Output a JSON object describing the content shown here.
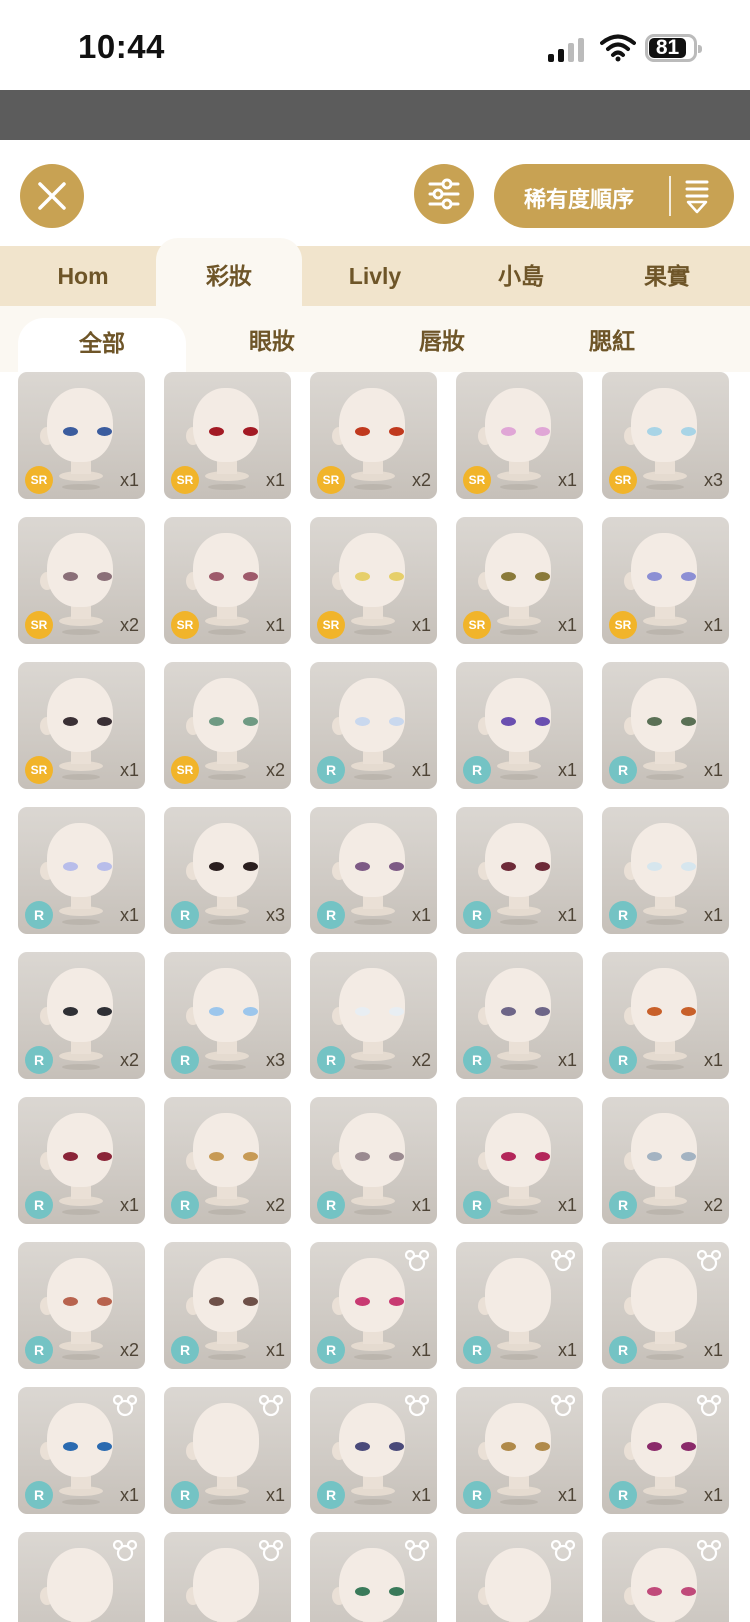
{
  "status_bar": {
    "time": "10:44",
    "battery": "81"
  },
  "toolbar": {
    "sort_label": "稀有度順序"
  },
  "tabs": [
    {
      "label": "Hom",
      "active": false
    },
    {
      "label": "彩妝",
      "active": true
    },
    {
      "label": "Livly",
      "active": false
    },
    {
      "label": "小島",
      "active": false
    },
    {
      "label": "果實",
      "active": false
    }
  ],
  "subtabs": [
    {
      "label": "全部",
      "active": true
    },
    {
      "label": "眼妝",
      "active": false
    },
    {
      "label": "唇妝",
      "active": false
    },
    {
      "label": "腮紅",
      "active": false
    }
  ],
  "items": [
    {
      "rarity": "SR",
      "qty": "x1",
      "eye": "#3b5c9e",
      "mouse": false
    },
    {
      "rarity": "SR",
      "qty": "x1",
      "eye": "#a31a24",
      "mouse": false
    },
    {
      "rarity": "SR",
      "qty": "x2",
      "eye": "#c0391e",
      "mouse": false
    },
    {
      "rarity": "SR",
      "qty": "x1",
      "eye": "#e0a6d6",
      "mouse": false
    },
    {
      "rarity": "SR",
      "qty": "x3",
      "eye": "#a8d4e6",
      "mouse": false
    },
    {
      "rarity": "SR",
      "qty": "x2",
      "eye": "#8a6f78",
      "mouse": false
    },
    {
      "rarity": "SR",
      "qty": "x1",
      "eye": "#9e5a6b",
      "mouse": false
    },
    {
      "rarity": "SR",
      "qty": "x1",
      "eye": "#e6cf6a",
      "mouse": false
    },
    {
      "rarity": "SR",
      "qty": "x1",
      "eye": "#8a7a3a",
      "mouse": false
    },
    {
      "rarity": "SR",
      "qty": "x1",
      "eye": "#8c8fd4",
      "mouse": false
    },
    {
      "rarity": "SR",
      "qty": "x1",
      "eye": "#3a3035",
      "mouse": false
    },
    {
      "rarity": "SR",
      "qty": "x2",
      "eye": "#6f9a83",
      "mouse": false
    },
    {
      "rarity": "R",
      "qty": "x1",
      "eye": "#c9d8ee",
      "mouse": false
    },
    {
      "rarity": "R",
      "qty": "x1",
      "eye": "#6a4fb0",
      "mouse": false
    },
    {
      "rarity": "R",
      "qty": "x1",
      "eye": "#5a7055",
      "mouse": false
    },
    {
      "rarity": "R",
      "qty": "x1",
      "eye": "#b8bdea",
      "mouse": false
    },
    {
      "rarity": "R",
      "qty": "x3",
      "eye": "#2a1e1e",
      "mouse": false
    },
    {
      "rarity": "R",
      "qty": "x1",
      "eye": "#7d5a85",
      "mouse": false
    },
    {
      "rarity": "R",
      "qty": "x1",
      "eye": "#6d2a38",
      "mouse": false
    },
    {
      "rarity": "R",
      "qty": "x1",
      "eye": "#d6e6ee",
      "mouse": false
    },
    {
      "rarity": "R",
      "qty": "x2",
      "eye": "#2f3035",
      "mouse": false
    },
    {
      "rarity": "R",
      "qty": "x3",
      "eye": "#9cc6ec",
      "mouse": false
    },
    {
      "rarity": "R",
      "qty": "x2",
      "eye": "#e8eef3",
      "mouse": false
    },
    {
      "rarity": "R",
      "qty": "x1",
      "eye": "#6e6688",
      "mouse": false
    },
    {
      "rarity": "R",
      "qty": "x1",
      "eye": "#c8602a",
      "mouse": false
    },
    {
      "rarity": "R",
      "qty": "x1",
      "eye": "#8a2438",
      "mouse": false
    },
    {
      "rarity": "R",
      "qty": "x2",
      "eye": "#c79a55",
      "mouse": false
    },
    {
      "rarity": "R",
      "qty": "x1",
      "eye": "#9a8a90",
      "mouse": false
    },
    {
      "rarity": "R",
      "qty": "x1",
      "eye": "#b3265a",
      "mouse": false
    },
    {
      "rarity": "R",
      "qty": "x2",
      "eye": "#a3b3c2",
      "mouse": false
    },
    {
      "rarity": "R",
      "qty": "x2",
      "eye": "#b8634e",
      "mouse": false
    },
    {
      "rarity": "R",
      "qty": "x1",
      "eye": "#6e5048",
      "mouse": false
    },
    {
      "rarity": "R",
      "qty": "x1",
      "eye": "#c83a72",
      "mouse": true
    },
    {
      "rarity": "R",
      "qty": "x1",
      "eye": "",
      "mouse": true
    },
    {
      "rarity": "R",
      "qty": "x1",
      "eye": "",
      "mouse": true
    },
    {
      "rarity": "R",
      "qty": "x1",
      "eye": "#2a6ab0",
      "mouse": true
    },
    {
      "rarity": "R",
      "qty": "x1",
      "eye": "",
      "mouse": true
    },
    {
      "rarity": "R",
      "qty": "x1",
      "eye": "#4a4a7a",
      "mouse": true
    },
    {
      "rarity": "R",
      "qty": "x1",
      "eye": "#b08a4a",
      "mouse": true
    },
    {
      "rarity": "R",
      "qty": "x1",
      "eye": "#8a2a6a",
      "mouse": true
    },
    {
      "rarity": "",
      "qty": "",
      "eye": "",
      "mouse": true
    },
    {
      "rarity": "",
      "qty": "",
      "eye": "",
      "mouse": true
    },
    {
      "rarity": "",
      "qty": "",
      "eye": "#3a7a5a",
      "mouse": true
    },
    {
      "rarity": "",
      "qty": "",
      "eye": "",
      "mouse": true
    },
    {
      "rarity": "",
      "qty": "",
      "eye": "#c04a7a",
      "mouse": true
    }
  ]
}
